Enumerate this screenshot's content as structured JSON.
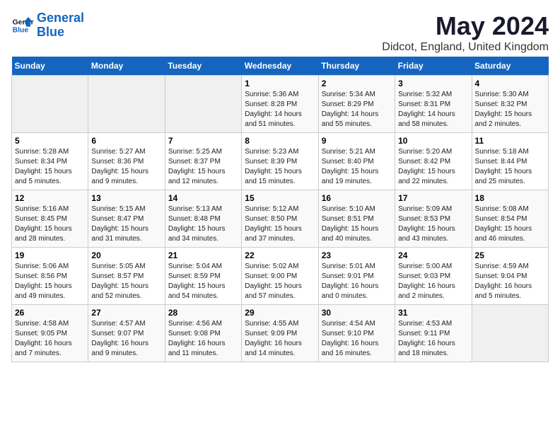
{
  "logo": {
    "line1": "General",
    "line2": "Blue"
  },
  "title": "May 2024",
  "subtitle": "Didcot, England, United Kingdom",
  "days_of_week": [
    "Sunday",
    "Monday",
    "Tuesday",
    "Wednesday",
    "Thursday",
    "Friday",
    "Saturday"
  ],
  "weeks": [
    [
      {
        "num": "",
        "info": ""
      },
      {
        "num": "",
        "info": ""
      },
      {
        "num": "",
        "info": ""
      },
      {
        "num": "1",
        "info": "Sunrise: 5:36 AM\nSunset: 8:28 PM\nDaylight: 14 hours\nand 51 minutes."
      },
      {
        "num": "2",
        "info": "Sunrise: 5:34 AM\nSunset: 8:29 PM\nDaylight: 14 hours\nand 55 minutes."
      },
      {
        "num": "3",
        "info": "Sunrise: 5:32 AM\nSunset: 8:31 PM\nDaylight: 14 hours\nand 58 minutes."
      },
      {
        "num": "4",
        "info": "Sunrise: 5:30 AM\nSunset: 8:32 PM\nDaylight: 15 hours\nand 2 minutes."
      }
    ],
    [
      {
        "num": "5",
        "info": "Sunrise: 5:28 AM\nSunset: 8:34 PM\nDaylight: 15 hours\nand 5 minutes."
      },
      {
        "num": "6",
        "info": "Sunrise: 5:27 AM\nSunset: 8:36 PM\nDaylight: 15 hours\nand 9 minutes."
      },
      {
        "num": "7",
        "info": "Sunrise: 5:25 AM\nSunset: 8:37 PM\nDaylight: 15 hours\nand 12 minutes."
      },
      {
        "num": "8",
        "info": "Sunrise: 5:23 AM\nSunset: 8:39 PM\nDaylight: 15 hours\nand 15 minutes."
      },
      {
        "num": "9",
        "info": "Sunrise: 5:21 AM\nSunset: 8:40 PM\nDaylight: 15 hours\nand 19 minutes."
      },
      {
        "num": "10",
        "info": "Sunrise: 5:20 AM\nSunset: 8:42 PM\nDaylight: 15 hours\nand 22 minutes."
      },
      {
        "num": "11",
        "info": "Sunrise: 5:18 AM\nSunset: 8:44 PM\nDaylight: 15 hours\nand 25 minutes."
      }
    ],
    [
      {
        "num": "12",
        "info": "Sunrise: 5:16 AM\nSunset: 8:45 PM\nDaylight: 15 hours\nand 28 minutes."
      },
      {
        "num": "13",
        "info": "Sunrise: 5:15 AM\nSunset: 8:47 PM\nDaylight: 15 hours\nand 31 minutes."
      },
      {
        "num": "14",
        "info": "Sunrise: 5:13 AM\nSunset: 8:48 PM\nDaylight: 15 hours\nand 34 minutes."
      },
      {
        "num": "15",
        "info": "Sunrise: 5:12 AM\nSunset: 8:50 PM\nDaylight: 15 hours\nand 37 minutes."
      },
      {
        "num": "16",
        "info": "Sunrise: 5:10 AM\nSunset: 8:51 PM\nDaylight: 15 hours\nand 40 minutes."
      },
      {
        "num": "17",
        "info": "Sunrise: 5:09 AM\nSunset: 8:53 PM\nDaylight: 15 hours\nand 43 minutes."
      },
      {
        "num": "18",
        "info": "Sunrise: 5:08 AM\nSunset: 8:54 PM\nDaylight: 15 hours\nand 46 minutes."
      }
    ],
    [
      {
        "num": "19",
        "info": "Sunrise: 5:06 AM\nSunset: 8:56 PM\nDaylight: 15 hours\nand 49 minutes."
      },
      {
        "num": "20",
        "info": "Sunrise: 5:05 AM\nSunset: 8:57 PM\nDaylight: 15 hours\nand 52 minutes."
      },
      {
        "num": "21",
        "info": "Sunrise: 5:04 AM\nSunset: 8:59 PM\nDaylight: 15 hours\nand 54 minutes."
      },
      {
        "num": "22",
        "info": "Sunrise: 5:02 AM\nSunset: 9:00 PM\nDaylight: 15 hours\nand 57 minutes."
      },
      {
        "num": "23",
        "info": "Sunrise: 5:01 AM\nSunset: 9:01 PM\nDaylight: 16 hours\nand 0 minutes."
      },
      {
        "num": "24",
        "info": "Sunrise: 5:00 AM\nSunset: 9:03 PM\nDaylight: 16 hours\nand 2 minutes."
      },
      {
        "num": "25",
        "info": "Sunrise: 4:59 AM\nSunset: 9:04 PM\nDaylight: 16 hours\nand 5 minutes."
      }
    ],
    [
      {
        "num": "26",
        "info": "Sunrise: 4:58 AM\nSunset: 9:05 PM\nDaylight: 16 hours\nand 7 minutes."
      },
      {
        "num": "27",
        "info": "Sunrise: 4:57 AM\nSunset: 9:07 PM\nDaylight: 16 hours\nand 9 minutes."
      },
      {
        "num": "28",
        "info": "Sunrise: 4:56 AM\nSunset: 9:08 PM\nDaylight: 16 hours\nand 11 minutes."
      },
      {
        "num": "29",
        "info": "Sunrise: 4:55 AM\nSunset: 9:09 PM\nDaylight: 16 hours\nand 14 minutes."
      },
      {
        "num": "30",
        "info": "Sunrise: 4:54 AM\nSunset: 9:10 PM\nDaylight: 16 hours\nand 16 minutes."
      },
      {
        "num": "31",
        "info": "Sunrise: 4:53 AM\nSunset: 9:11 PM\nDaylight: 16 hours\nand 18 minutes."
      },
      {
        "num": "",
        "info": ""
      }
    ]
  ]
}
